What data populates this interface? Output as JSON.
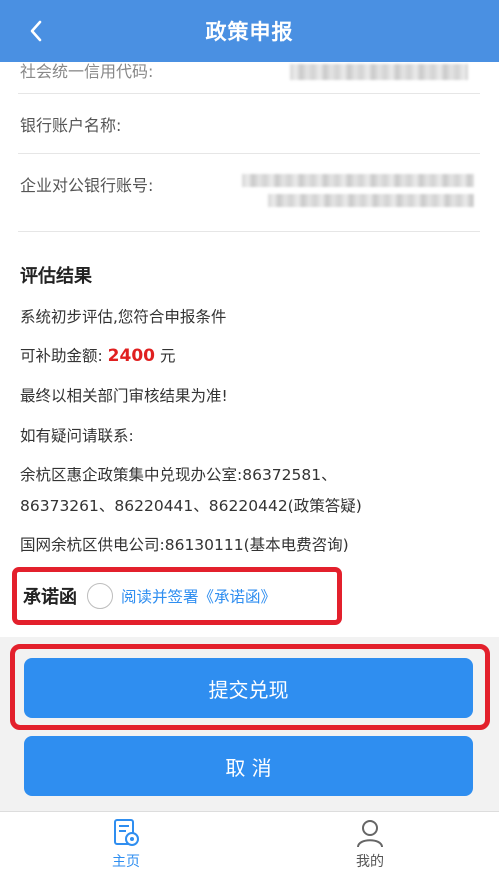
{
  "header": {
    "title": "政策申报"
  },
  "fields": {
    "credit_code_label": "社会统一信用代码:",
    "bank_account_name_label": "银行账户名称:",
    "corporate_account_label": "企业对公银行账号:"
  },
  "evaluation": {
    "title": "评估结果",
    "line1": "系统初步评估,您符合申报条件",
    "subsidy_prefix": "可补助金额:",
    "subsidy_amount": "2400",
    "subsidy_unit": "元",
    "line3": "最终以相关部门审核结果为准!",
    "line4": "如有疑问请联系:",
    "contact1_line1": "余杭区惠企政策集中兑现办公室:86372581、",
    "contact1_line2": "86373261、86220441、86220442(政策答疑)",
    "contact2": "国网余杭区供电公司:86130111(基本电费咨询)"
  },
  "promise": {
    "label": "承诺函",
    "link": "阅读并签署《承诺函》"
  },
  "buttons": {
    "submit": "提交兑现",
    "cancel": "取 消"
  },
  "tabs": [
    {
      "label": "主页",
      "active": true
    },
    {
      "label": "我的",
      "active": false
    }
  ],
  "colors": {
    "header": "#4a90e2",
    "primary": "#2f8ef0",
    "amount": "#e02020",
    "highlight": "#e3202c"
  }
}
